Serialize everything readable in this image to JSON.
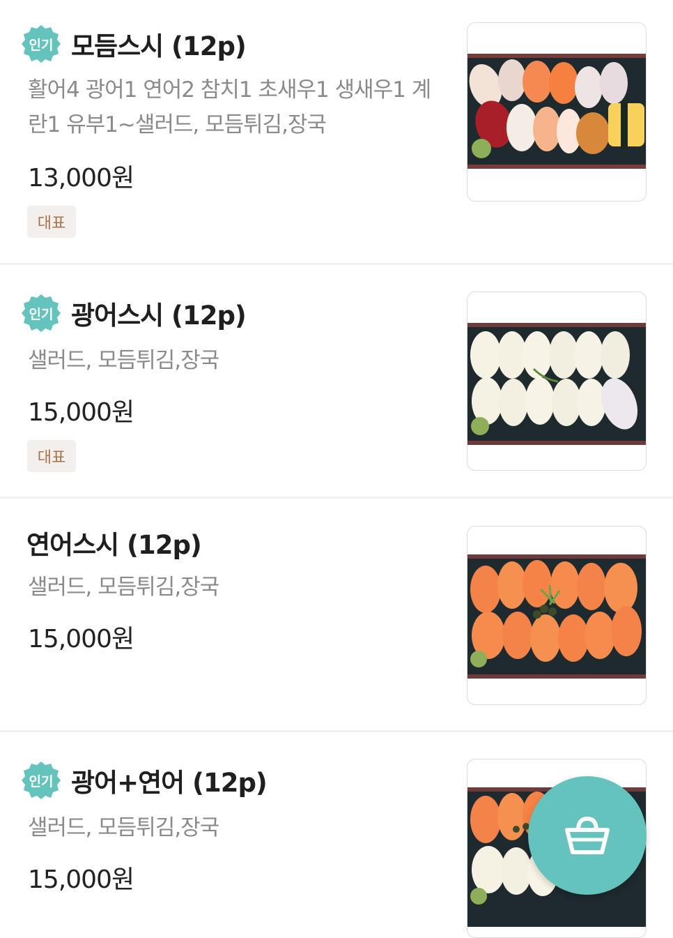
{
  "colors": {
    "accent": "#64c3bd",
    "tag_bg": "#f2efec",
    "tag_text": "#a4734a",
    "desc_text": "#8a8a8a"
  },
  "menu": {
    "items": [
      {
        "popular_label": "인기",
        "name": "모듬스시 (12p)",
        "desc_line1": "활어4 광어1 연어2 참치1 초새우1 생새우1 계",
        "desc_line2": "란1 유부1~샐러드, 모듬튀김,장국",
        "price": "13,000원",
        "tag": "대표"
      },
      {
        "popular_label": "인기",
        "name": "광어스시 (12p)",
        "desc_line1": "샐러드, 모듬튀김,장국",
        "price": "15,000원",
        "tag": "대표"
      },
      {
        "name": "연어스시 (12p)",
        "desc_line1": "샐러드, 모듬튀김,장국",
        "price": "15,000원"
      },
      {
        "popular_label": "인기",
        "name": "광어+연어 (12p)",
        "desc_line1": "샐러드, 모듬튀김,장국",
        "price": "15,000원"
      }
    ]
  },
  "cart_button": {
    "icon": "basket-icon"
  }
}
